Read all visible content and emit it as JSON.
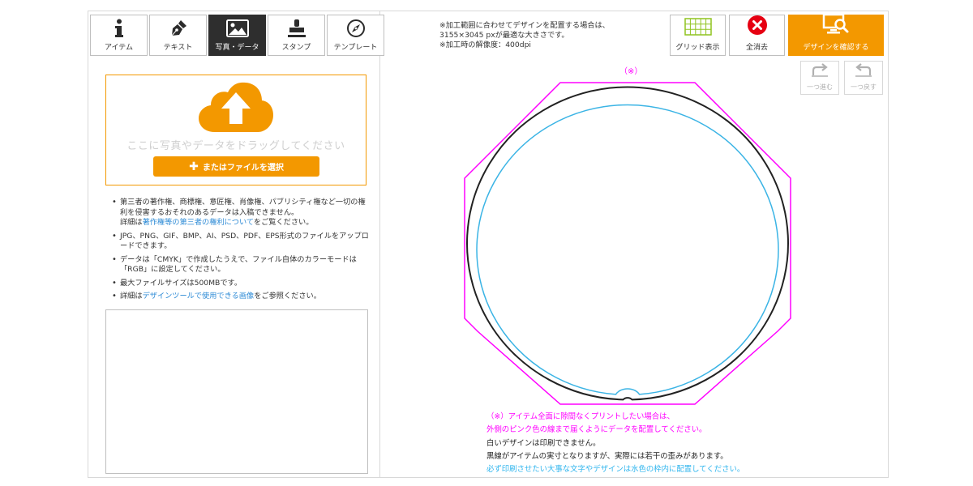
{
  "tabs": [
    {
      "label": "アイテム",
      "icon": "info-icon"
    },
    {
      "label": "テキスト",
      "icon": "pen-icon"
    },
    {
      "label": "写真・データ",
      "icon": "image-icon",
      "active": true
    },
    {
      "label": "スタンプ",
      "icon": "stamp-icon"
    },
    {
      "label": "テンプレート",
      "icon": "compass-icon"
    }
  ],
  "upload": {
    "drag_text": "ここに写真やデータをドラッグしてください",
    "choose_label": "またはファイルを選択",
    "icon": "cloud-upload-icon"
  },
  "notes": {
    "n1": "第三者の著作権、商標権、意匠権、肖像権、パブリシティ権など一切の権利を侵害するおそれのあるデータは入稿できません。",
    "n1_pre": "詳細は",
    "n1_link": "著作権等の第三者の権利について",
    "n1_post": "をご覧ください。",
    "n2": "JPG、PNG、GIF、BMP、AI、PSD、PDF、EPS形式のファイルをアップロードできます。",
    "n3": "データは「CMYK」で作成したうえで、ファイル自体のカラーモードは「RGB」に設定してください。",
    "n4": "最大ファイルサイズは500MBです。",
    "n5_pre": "詳細は",
    "n5_link": "デザインツールで使用できる画像",
    "n5_post": "をご参照ください。"
  },
  "info": {
    "line1": "※加工範囲に合わせてデザインを配置する場合は、",
    "line2": "3155×3045 pxが最適な大きさです。",
    "line3": "※加工時の解像度：400dpi"
  },
  "toolbar": {
    "grid_label": "グリッド表示",
    "clear_label": "全消去",
    "confirm_label": "デザインを確認する",
    "redo_label": "一つ進む",
    "undo_label": "一つ戻す"
  },
  "canvas": {
    "mark": "（※）",
    "bleed_color": "#ff00ff",
    "trim_color": "#222222",
    "safe_color": "#3bb4e5"
  },
  "bottom_notes": {
    "pink1": "（※）アイテム全面に隙間なくプリントしたい場合は、",
    "pink2": "外側のピンク色の線まで届くようにデータを配置してください。",
    "dark1": "白いデザインは印刷できません。",
    "dark2": "黒線がアイテムの実寸となりますが、実際には若干の歪みがあります。",
    "blue1": "必ず印刷させたい大事な文字やデザインは水色の枠内に配置してください。"
  },
  "colors": {
    "accent": "#f39800",
    "active_tab": "#2e2e2e",
    "link": "#2e8bd6",
    "clear_red": "#e60012",
    "grid_green": "#8fc31f"
  }
}
